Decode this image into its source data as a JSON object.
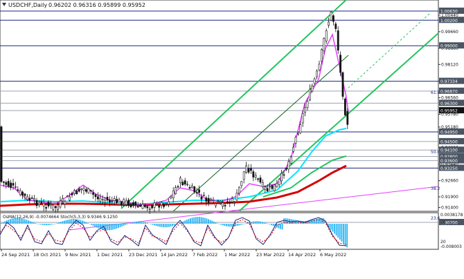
{
  "header": {
    "symbol": "USDCHF,Daily",
    "ohlc": "0.96202 0.96316 0.95899 0.95952"
  },
  "price_axis": {
    "ticks": [
      "1.00440",
      "0.99660",
      "0.98880",
      "0.98120",
      "0.97334",
      "0.96560",
      "0.95780",
      "0.95180",
      "0.94220",
      "0.93440",
      "0.92660",
      "0.91900",
      "0.91400",
      "0.90680"
    ],
    "levels": [
      {
        "value": "1.00630",
        "color": "#4b5563"
      },
      {
        "value": "1.00200",
        "color": "#4b5563"
      },
      {
        "value": "0.99000",
        "color": "#4b5563"
      },
      {
        "value": "0.97334",
        "color": "#4b5563"
      },
      {
        "value": "0.96870",
        "color": "#4b5563"
      },
      {
        "value": "0.96300",
        "color": "#4b5563"
      },
      {
        "value": "0.95952",
        "color": "#111111"
      },
      {
        "value": "0.94950",
        "color": "#4b5563"
      },
      {
        "value": "0.94500",
        "color": "#4b5563"
      },
      {
        "value": "0.94100",
        "color": "#4b5563"
      },
      {
        "value": "0.93800",
        "color": "#4b5563"
      },
      {
        "value": "0.93600",
        "color": "#4b5563"
      },
      {
        "value": "0.93250",
        "color": "#4b5563"
      },
      {
        "value": "0.90700",
        "color": "#4b5563"
      }
    ],
    "fib_labels": [
      "61.8",
      "50.0",
      "38.2",
      "23.6"
    ]
  },
  "indicator": {
    "label": "OsMA(12,26,9) -0.0074664  Stoch(5,3,3) 9.9346 9.1250",
    "axis": [
      "0.0038178",
      "80",
      "20",
      "-0.008003"
    ]
  },
  "time_axis": [
    "24 Sep 2021",
    "18 Oct 2021",
    "9 Nov 2021",
    "1 Dec 2021",
    "23 Dec 2021",
    "14 Jan 2022",
    "7 Feb 2022",
    "1 Mar 2022",
    "23 Mar 2022",
    "14 Apr 2022",
    "6 May 2022"
  ],
  "colors": {
    "bull_candle": "#111111",
    "bear_candle": "#111111",
    "channel": "#22c55e",
    "ema_fast": "#e040fb",
    "ema_mid": "#00e5ff",
    "ema_slow": "#d50000",
    "hline": "#1a237e",
    "osma": "#29b6f6",
    "stoch": "#1a237e"
  }
}
